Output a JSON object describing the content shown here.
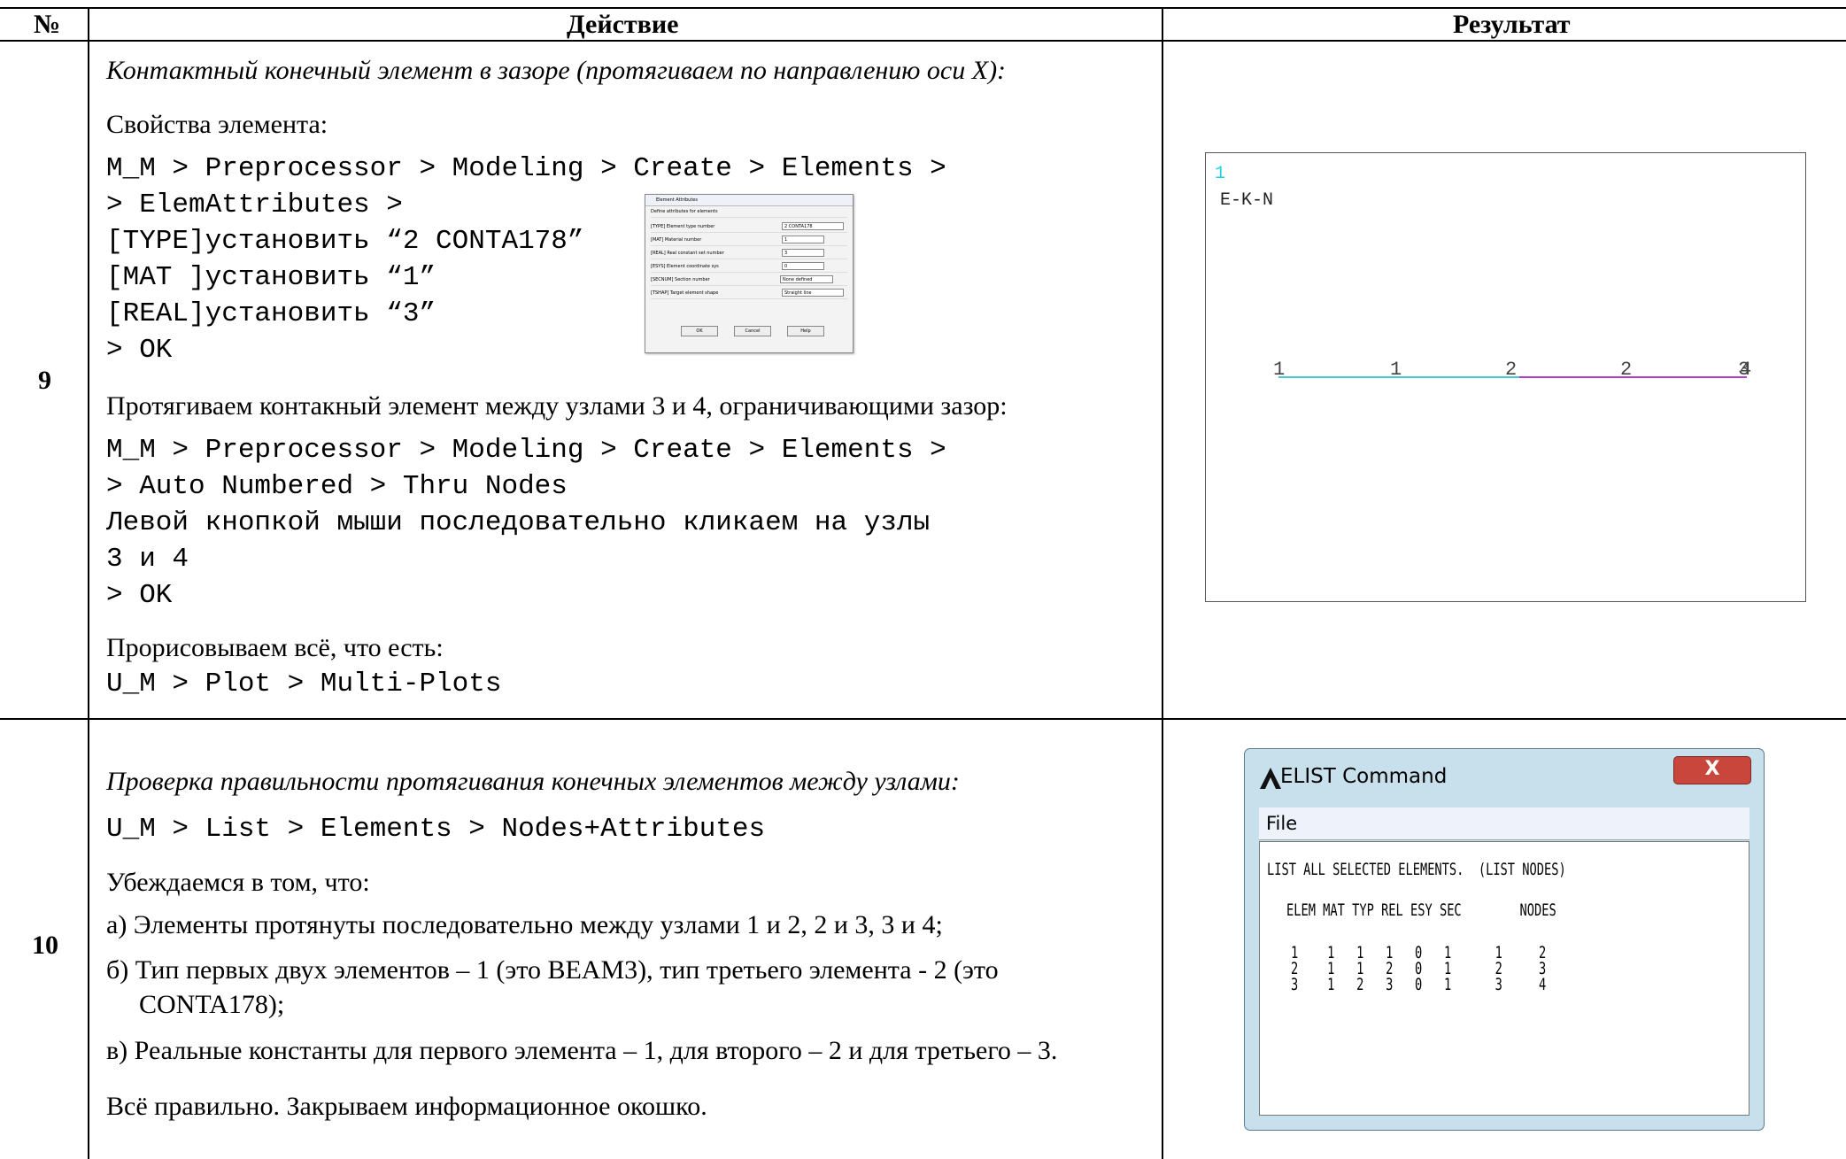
{
  "header": {
    "num": "№",
    "action": "Действие",
    "result": "Результат"
  },
  "row9": {
    "num": "9",
    "intro": "Контактный конечный элемент в зазоре (протягиваем по направлению оси X):",
    "props_label": "Свойства элемента:",
    "code1": [
      "M_M > Preprocessor > Modeling > Create > Elements >",
      "> ElemAttributes >",
      "[TYPE]установить “2 CONTA178”",
      "[MAT ]установить “1”",
      "[REAL]установить “3”",
      "> OK"
    ],
    "stretch_text": "Протягиваем контакный элемент между узлами 3 и 4, ограничивающими зазор:",
    "code2": [
      "M_M > Preprocessor > Modeling > Create > Elements >",
      "> Auto Numbered > Thru Nodes",
      "Левой кнопкой мыши последовательно кликаем на узлы",
      "3 и 4",
      "> OK"
    ],
    "draw_text": "Прорисовываем всё, что есть:",
    "code3": "U_M > Plot > Multi-Plots",
    "dialog": {
      "title": "Element Attributes",
      "subtitle": "Define attributes for elements",
      "rows": [
        {
          "label": "[TYPE] Element type number",
          "value": "2  CONTA178"
        },
        {
          "label": "[MAT]  Material number",
          "value": "1"
        },
        {
          "label": "[REAL] Real constant set number",
          "value": "3"
        },
        {
          "label": "[ESYS] Element coordinate sys",
          "value": "0"
        },
        {
          "label": "[SECNUM] Section number",
          "value": "None defined"
        },
        {
          "label": "[TSHAP] Target element shape",
          "value": "Straight line"
        }
      ],
      "ok": "OK",
      "cancel": "Cancel",
      "help": "Help"
    },
    "plot": {
      "corner": "1",
      "label": "E-K-N",
      "numbers": [
        "1",
        "1",
        "2",
        "2",
        "3",
        "4"
      ],
      "colors": {
        "beam": "#46c8d0",
        "contact": "#b43cc8",
        "corner": "#23d0e0"
      }
    }
  },
  "row10": {
    "num": "10",
    "intro": "Проверка правильности протягивания конечных элементов между узлами:",
    "code": "U_M > List > Elements > Nodes+Attributes",
    "check_label": "Убеждаемся в том, что:",
    "item_a": "а) Элементы протянуты последовательно между узлами 1 и 2, 2 и 3, 3 и 4;",
    "item_b1": "б) Тип первых двух элементов – 1 (это BEAM3), тип третьего элемента - 2 (это",
    "item_b2": "CONTA178);",
    "item_c": "в) Реальные константы для первого элемента – 1, для второго – 2 и для третьего – 3.",
    "conclusion": "Всё правильно. Закрываем информационное окошко.",
    "elist": {
      "title": "ELIST   Command",
      "close": "X",
      "menu": "File",
      "lines": [
        "LIST ALL SELECTED ELEMENTS.  (LIST NODES)",
        "ELEM MAT TYP REL ESY SEC        NODES",
        "1    1   1   1   0   1      1     2",
        "2    1   1   2   0   1      2     3",
        "3    1   2   3   0   1      3     4"
      ]
    }
  }
}
